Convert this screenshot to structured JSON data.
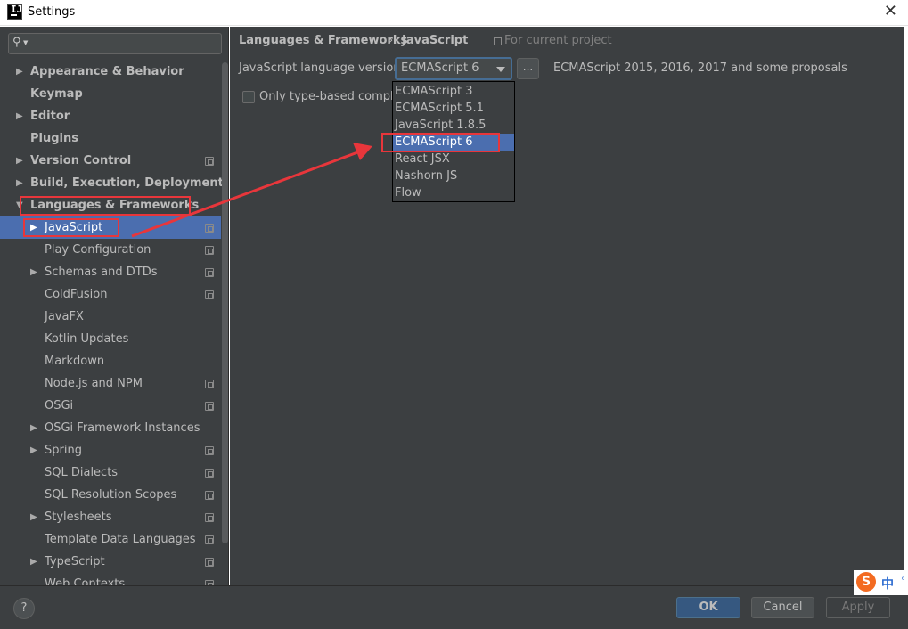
{
  "window": {
    "app_icon_letters": "IJ",
    "title": "Settings",
    "close_glyph": "✕"
  },
  "search": {
    "icon": "search-icon",
    "value": ""
  },
  "tree": {
    "items": [
      {
        "label": "Appearance & Behavior",
        "bold": true,
        "expandable": true,
        "level": 0,
        "project": false
      },
      {
        "label": "Keymap",
        "bold": true,
        "expandable": false,
        "level": 0,
        "project": false
      },
      {
        "label": "Editor",
        "bold": true,
        "expandable": true,
        "level": 0,
        "project": false
      },
      {
        "label": "Plugins",
        "bold": true,
        "expandable": false,
        "level": 0,
        "project": false
      },
      {
        "label": "Version Control",
        "bold": true,
        "expandable": true,
        "level": 0,
        "project": true
      },
      {
        "label": "Build, Execution, Deployment",
        "bold": true,
        "expandable": true,
        "level": 0,
        "project": false
      },
      {
        "label": "Languages & Frameworks",
        "bold": true,
        "expanded": true,
        "level": 0,
        "project": false
      },
      {
        "label": "JavaScript",
        "bold": false,
        "expandable": true,
        "level": 1,
        "project": true,
        "selected": true
      },
      {
        "label": "Play Configuration",
        "bold": false,
        "expandable": false,
        "level": 1,
        "project": true
      },
      {
        "label": "Schemas and DTDs",
        "bold": false,
        "expandable": true,
        "level": 1,
        "project": true
      },
      {
        "label": "ColdFusion",
        "bold": false,
        "expandable": false,
        "level": 1,
        "project": true
      },
      {
        "label": "JavaFX",
        "bold": false,
        "expandable": false,
        "level": 1,
        "project": false
      },
      {
        "label": "Kotlin Updates",
        "bold": false,
        "expandable": false,
        "level": 1,
        "project": false
      },
      {
        "label": "Markdown",
        "bold": false,
        "expandable": false,
        "level": 1,
        "project": false
      },
      {
        "label": "Node.js and NPM",
        "bold": false,
        "expandable": false,
        "level": 1,
        "project": true
      },
      {
        "label": "OSGi",
        "bold": false,
        "expandable": false,
        "level": 1,
        "project": true
      },
      {
        "label": "OSGi Framework Instances",
        "bold": false,
        "expandable": true,
        "level": 1,
        "project": false
      },
      {
        "label": "Spring",
        "bold": false,
        "expandable": true,
        "level": 1,
        "project": true
      },
      {
        "label": "SQL Dialects",
        "bold": false,
        "expandable": false,
        "level": 1,
        "project": true
      },
      {
        "label": "SQL Resolution Scopes",
        "bold": false,
        "expandable": false,
        "level": 1,
        "project": true
      },
      {
        "label": "Stylesheets",
        "bold": false,
        "expandable": true,
        "level": 1,
        "project": true
      },
      {
        "label": "Template Data Languages",
        "bold": false,
        "expandable": false,
        "level": 1,
        "project": true
      },
      {
        "label": "TypeScript",
        "bold": false,
        "expandable": true,
        "level": 1,
        "project": true
      },
      {
        "label": "Web Contexts",
        "bold": false,
        "expandable": false,
        "level": 1,
        "project": true
      }
    ]
  },
  "content": {
    "breadcrumb_parent": "Languages & Frameworks",
    "breadcrumb_sep": "›",
    "breadcrumb_current": "JavaScript",
    "project_hint": "For current project",
    "language_version_label": "JavaScript language version",
    "language_version_value": "ECMAScript 6",
    "browse_button": "...",
    "language_description": "ECMAScript 2015, 2016, 2017 and some proposals",
    "only_type_based_label": "Only type-based completi",
    "only_type_based_checked": false
  },
  "dropdown": {
    "options": [
      "ECMAScript 3",
      "ECMAScript 5.1",
      "JavaScript 1.8.5",
      "ECMAScript 6",
      "React JSX",
      "Nashorn JS",
      "Flow"
    ],
    "selected": "ECMAScript 6"
  },
  "footer": {
    "help": "?",
    "ok": "OK",
    "cancel": "Cancel",
    "apply": "Apply"
  },
  "ime": {
    "logo": "S",
    "mode": "中",
    "dot": "°"
  },
  "colors": {
    "background": "#3c3f41",
    "selection": "#4b6eaf",
    "annotation_red": "#e8363b",
    "text": "#bbbbbb"
  }
}
